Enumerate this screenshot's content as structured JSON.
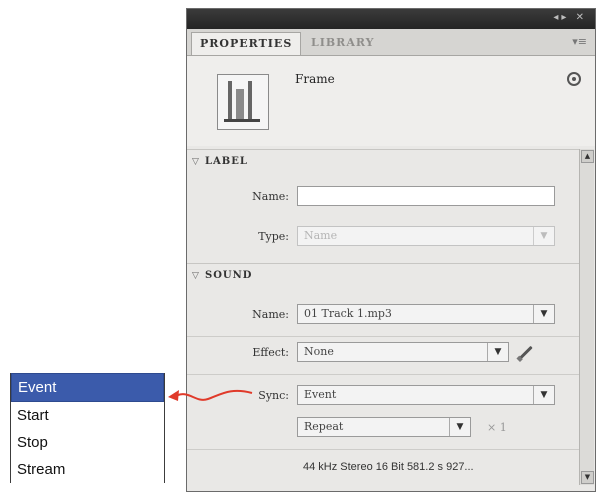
{
  "panel": {
    "tabs": {
      "properties": "PROPERTIES",
      "library": "LIBRARY"
    },
    "frame": {
      "label": "Frame"
    },
    "label_section": {
      "header": "LABEL",
      "name_label": "Name:",
      "name_value": "",
      "type_label": "Type:",
      "type_value": "Name"
    },
    "sound_section": {
      "header": "SOUND",
      "name_label": "Name:",
      "name_value": "01 Track 1.mp3",
      "effect_label": "Effect:",
      "effect_value": "None",
      "sync_label": "Sync:",
      "sync_value": "Event",
      "repeat_value": "Repeat",
      "times_text": "× 1",
      "info": "44 kHz Stereo 16 Bit 581.2 s 927..."
    }
  },
  "sync_options": [
    "Event",
    "Start",
    "Stop",
    "Stream"
  ],
  "colors": {
    "selection": "#3b5bab",
    "arrow": "#e03a2a",
    "titlebar": "#2c2c2c"
  }
}
